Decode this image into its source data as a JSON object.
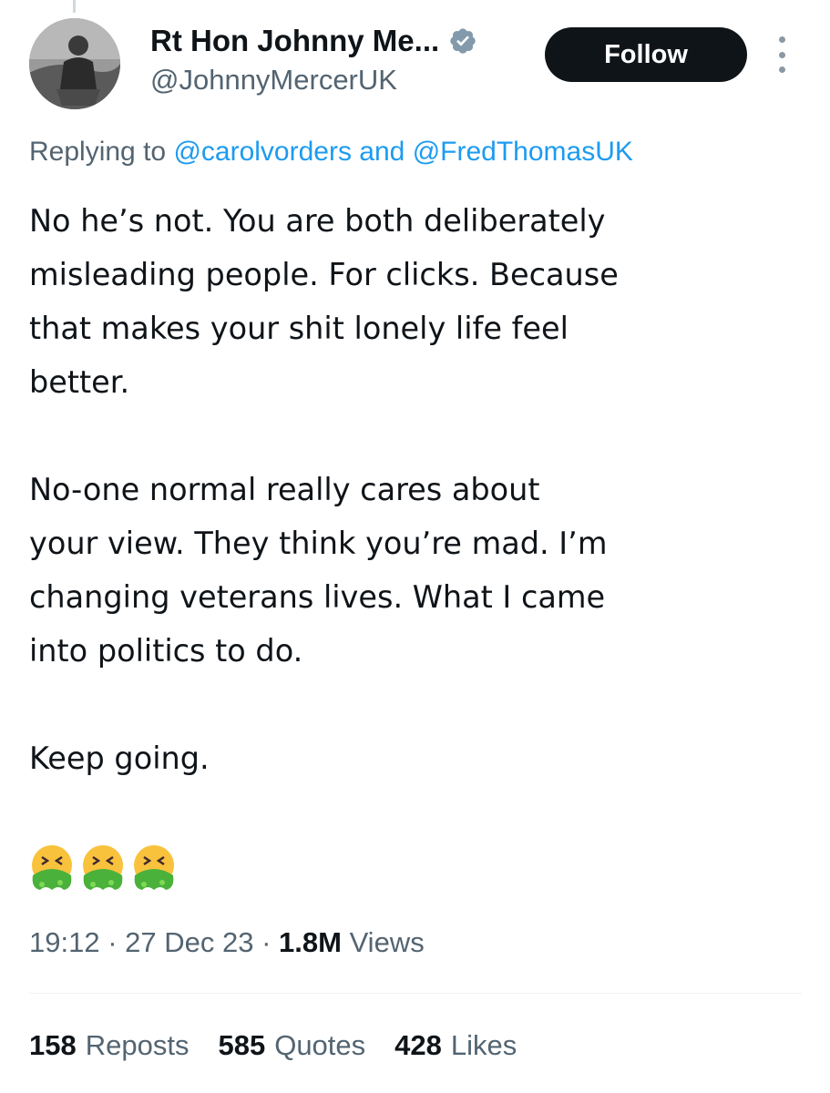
{
  "user": {
    "display_name": "Rt Hon Johnny Me...",
    "handle": "@JohnnyMercerUK",
    "verified_icon": "verified-badge-icon",
    "verified_color": "#829aab"
  },
  "follow_label": "Follow",
  "reply_context": {
    "prefix": "Replying to ",
    "mention_1": "@carolvorders",
    "conjunction": " and ",
    "mention_2": "@FredThomasUK"
  },
  "tweet": {
    "paragraphs": [
      "No he’s not. You are both deliberately\nmisleading people. For clicks. Because\nthat makes your shit lonely life feel\nbetter.",
      "No-one normal really cares about\nyour view. They think you’re mad. I’m\nchanging veterans lives. What I came\ninto politics to do.",
      "Keep going."
    ],
    "emojis": [
      "vomiting-face-emoji",
      "vomiting-face-emoji",
      "vomiting-face-emoji"
    ]
  },
  "meta": {
    "time": "19:12",
    "separator": " · ",
    "date": "27 Dec 23",
    "views_count": "1.8M",
    "views_label": " Views"
  },
  "stats": {
    "reposts_count": "158",
    "reposts_label": "Reposts",
    "quotes_count": "585",
    "quotes_label": "Quotes",
    "likes_count": "428",
    "likes_label": "Likes"
  },
  "colors": {
    "accent": "#1d9bf0",
    "secondary_text": "#536471",
    "primary_text": "#0f1419",
    "follow_bg": "#0f1419"
  }
}
